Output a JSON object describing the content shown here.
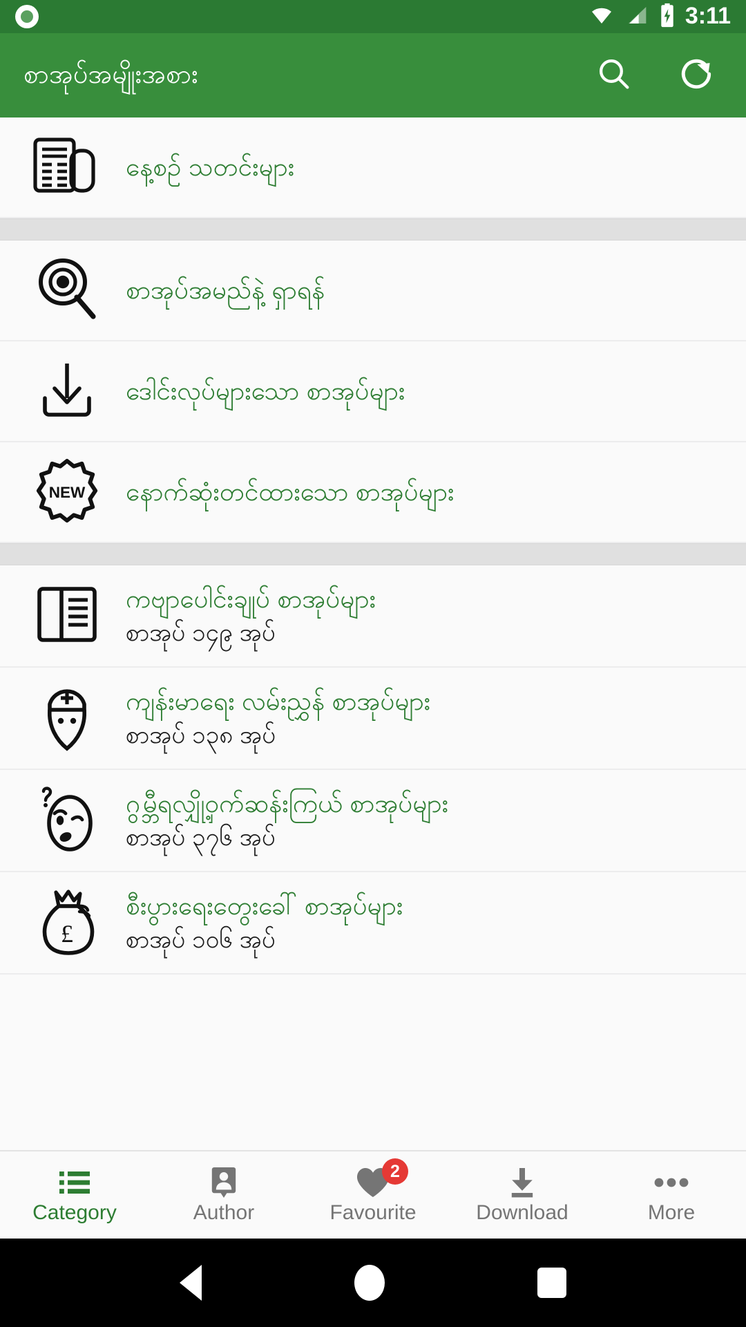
{
  "status_bar": {
    "notification_icon": "circle-record-icon",
    "wifi_icon": "wifi-icon",
    "signal_icon": "cell-signal-icon",
    "battery_icon": "battery-charging-icon",
    "time": "3:11",
    "background": "#2b7a33"
  },
  "app_bar": {
    "title": "စာအုပ်အမျိုးအစား",
    "search_icon": "search-icon",
    "refresh_icon": "refresh-icon",
    "background": "#388e3c",
    "text_color": "#ffffff"
  },
  "colors": {
    "accent_green": "#2d7d32",
    "list_background": "#fafafa",
    "section_divider": "#e0e0e0",
    "badge_red": "#e53935",
    "inactive_gray": "#757575"
  },
  "sections": [
    {
      "rows": [
        {
          "icon": "newspaper-icon",
          "title": "နေ့စဉ် သတင်းများ",
          "subtitle": ""
        }
      ]
    },
    {
      "rows": [
        {
          "icon": "eye-search-icon",
          "title": "စာအုပ်အမည်နဲ့ ရှာရန်",
          "subtitle": ""
        },
        {
          "icon": "download-tray-icon",
          "title": "ဒေါင်းလုပ်များသော စာအုပ်များ",
          "subtitle": ""
        },
        {
          "icon": "new-burst-icon",
          "title": "နောက်ဆုံးတင်ထားသော စာအုပ်များ",
          "subtitle": ""
        }
      ]
    },
    {
      "rows": [
        {
          "icon": "open-book-icon",
          "title": "ကဗျာပေါင်းချုပ် စာအုပ်များ",
          "subtitle": "စာအုပ် ၁၄၉ အုပ်"
        },
        {
          "icon": "doctor-head-icon",
          "title": "ကျန်းမာရေး လမ်းညွှန် စာအုပ်များ",
          "subtitle": "စာအုပ် ၁၃၈ အုပ်"
        },
        {
          "icon": "mystery-face-icon",
          "title": "ဂွမ္ဘီရလျှို့ဝှက်ဆန်းကြယ် စာအုပ်များ",
          "subtitle": "စာအုပ် ၃၇၆ အုပ်"
        },
        {
          "icon": "money-bag-icon",
          "title": "စီးပွားရေးတွေးခေါ် စာအုပ်များ",
          "subtitle": "စာအုပ် ၁၀၆ အုပ်"
        }
      ]
    }
  ],
  "bottom_nav": {
    "items": [
      {
        "icon": "list-bullet-icon",
        "label": "Category",
        "active": true,
        "badge": ""
      },
      {
        "icon": "person-card-icon",
        "label": "Author",
        "active": false,
        "badge": ""
      },
      {
        "icon": "heart-icon",
        "label": "Favourite",
        "active": false,
        "badge": "2"
      },
      {
        "icon": "download-icon",
        "label": "Download",
        "active": false,
        "badge": ""
      },
      {
        "icon": "more-dots-icon",
        "label": "More",
        "active": false,
        "badge": ""
      }
    ]
  },
  "system_nav": {
    "back_icon": "back-triangle-icon",
    "home_icon": "home-circle-icon",
    "recents_icon": "recents-square-icon"
  }
}
